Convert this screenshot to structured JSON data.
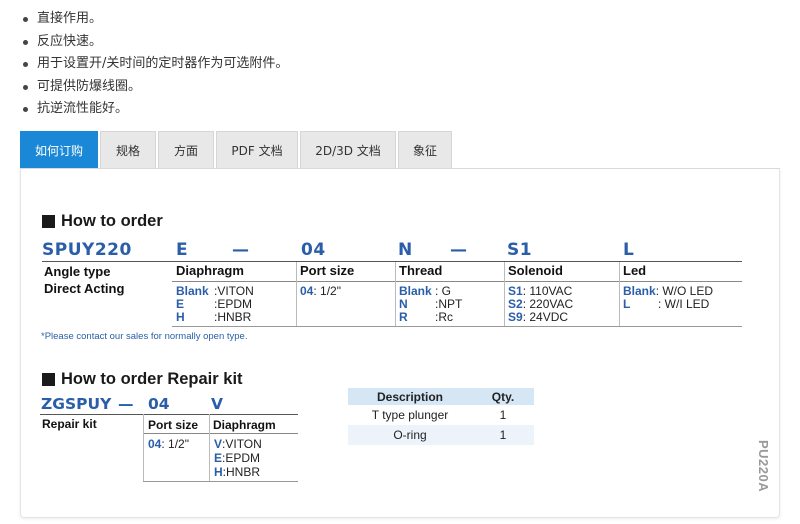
{
  "features": [
    "直接作用。",
    "反应快速。",
    "用于设置开/关时间的定时器作为可选附件。",
    "可提供防爆线圈。",
    "抗逆流性能好。"
  ],
  "tabs": [
    "如何订购",
    "规格",
    "方面",
    "PDF 文档",
    "2D/3D 文档",
    "象征"
  ],
  "order": {
    "title": "How to order",
    "code": {
      "model": "SPUY220",
      "p1": "E",
      "d1": "—",
      "p2": "04",
      "p3": "N",
      "d2": "—",
      "p4": "S1",
      "p5": "L"
    },
    "headers": {
      "angle": "Angle type",
      "diaphragm": "Diaphragm",
      "port": "Port size",
      "thread": "Thread",
      "solenoid": "Solenoid",
      "led": "Led"
    },
    "angle_sub": "Direct Acting",
    "diaphragm": [
      {
        "key": "Blank",
        "val": ":VITON"
      },
      {
        "key": "E",
        "val": ":EPDM"
      },
      {
        "key": "H",
        "val": ":HNBR"
      }
    ],
    "port": [
      {
        "key": "04",
        "val": ": 1/2\""
      }
    ],
    "thread": [
      {
        "key": "Blank",
        "val": ": G"
      },
      {
        "key": "N",
        "val": ":NPT"
      },
      {
        "key": "R",
        "val": ":Rc"
      }
    ],
    "solenoid": [
      {
        "key": "S1",
        "val": ": 110VAC"
      },
      {
        "key": "S2",
        "val": ": 220VAC"
      },
      {
        "key": "S9",
        "val": ": 24VDC"
      }
    ],
    "led": [
      {
        "key": "Blank",
        "val": ": W/O LED"
      },
      {
        "key": "L",
        "val": ": W/I LED"
      }
    ],
    "note": "*Please contact our sales for normally open type."
  },
  "repair": {
    "title": "How to order Repair kit",
    "code": {
      "model": "ZGSPUY",
      "dash": "—",
      "p1": "04",
      "p2": "V"
    },
    "label": "Repair kit",
    "headers": {
      "port": "Port size",
      "diaphragm": "Diaphragm"
    },
    "port": [
      {
        "key": "04",
        "val": ": 1/2\""
      }
    ],
    "diaphragm": [
      {
        "key": "V",
        "val": ":VITON"
      },
      {
        "key": "E",
        "val": ":EPDM"
      },
      {
        "key": "H",
        "val": ":HNBR"
      }
    ]
  },
  "desc_table": {
    "headers": [
      "Description",
      "Qty."
    ],
    "rows": [
      [
        "T type plunger",
        "1"
      ],
      [
        "O-ring",
        "1"
      ]
    ]
  },
  "side_tag": "PU220A",
  "colors": {
    "accent": "#1a88d6",
    "code_blue": "#2a5ea8"
  }
}
